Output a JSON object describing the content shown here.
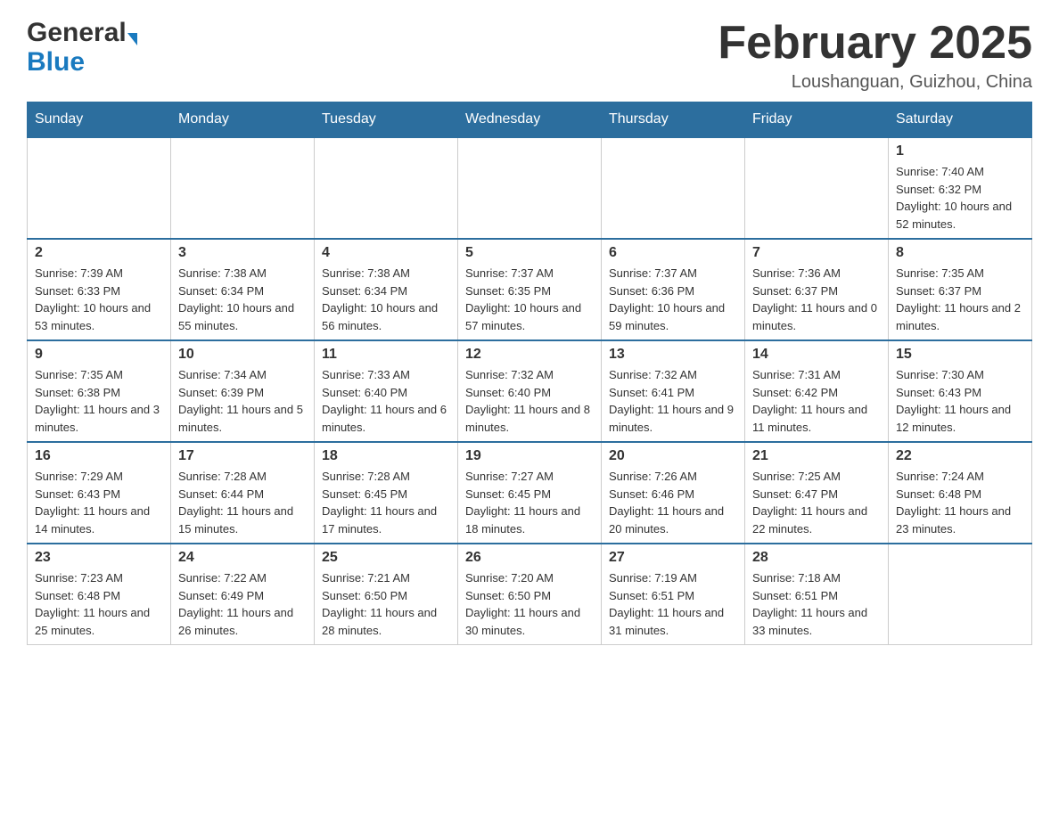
{
  "logo": {
    "general": "General",
    "blue": "Blue"
  },
  "title": "February 2025",
  "subtitle": "Loushanguan, Guizhou, China",
  "days_of_week": [
    "Sunday",
    "Monday",
    "Tuesday",
    "Wednesday",
    "Thursday",
    "Friday",
    "Saturday"
  ],
  "weeks": [
    [
      {
        "day": "",
        "info": ""
      },
      {
        "day": "",
        "info": ""
      },
      {
        "day": "",
        "info": ""
      },
      {
        "day": "",
        "info": ""
      },
      {
        "day": "",
        "info": ""
      },
      {
        "day": "",
        "info": ""
      },
      {
        "day": "1",
        "info": "Sunrise: 7:40 AM\nSunset: 6:32 PM\nDaylight: 10 hours and 52 minutes."
      }
    ],
    [
      {
        "day": "2",
        "info": "Sunrise: 7:39 AM\nSunset: 6:33 PM\nDaylight: 10 hours and 53 minutes."
      },
      {
        "day": "3",
        "info": "Sunrise: 7:38 AM\nSunset: 6:34 PM\nDaylight: 10 hours and 55 minutes."
      },
      {
        "day": "4",
        "info": "Sunrise: 7:38 AM\nSunset: 6:34 PM\nDaylight: 10 hours and 56 minutes."
      },
      {
        "day": "5",
        "info": "Sunrise: 7:37 AM\nSunset: 6:35 PM\nDaylight: 10 hours and 57 minutes."
      },
      {
        "day": "6",
        "info": "Sunrise: 7:37 AM\nSunset: 6:36 PM\nDaylight: 10 hours and 59 minutes."
      },
      {
        "day": "7",
        "info": "Sunrise: 7:36 AM\nSunset: 6:37 PM\nDaylight: 11 hours and 0 minutes."
      },
      {
        "day": "8",
        "info": "Sunrise: 7:35 AM\nSunset: 6:37 PM\nDaylight: 11 hours and 2 minutes."
      }
    ],
    [
      {
        "day": "9",
        "info": "Sunrise: 7:35 AM\nSunset: 6:38 PM\nDaylight: 11 hours and 3 minutes."
      },
      {
        "day": "10",
        "info": "Sunrise: 7:34 AM\nSunset: 6:39 PM\nDaylight: 11 hours and 5 minutes."
      },
      {
        "day": "11",
        "info": "Sunrise: 7:33 AM\nSunset: 6:40 PM\nDaylight: 11 hours and 6 minutes."
      },
      {
        "day": "12",
        "info": "Sunrise: 7:32 AM\nSunset: 6:40 PM\nDaylight: 11 hours and 8 minutes."
      },
      {
        "day": "13",
        "info": "Sunrise: 7:32 AM\nSunset: 6:41 PM\nDaylight: 11 hours and 9 minutes."
      },
      {
        "day": "14",
        "info": "Sunrise: 7:31 AM\nSunset: 6:42 PM\nDaylight: 11 hours and 11 minutes."
      },
      {
        "day": "15",
        "info": "Sunrise: 7:30 AM\nSunset: 6:43 PM\nDaylight: 11 hours and 12 minutes."
      }
    ],
    [
      {
        "day": "16",
        "info": "Sunrise: 7:29 AM\nSunset: 6:43 PM\nDaylight: 11 hours and 14 minutes."
      },
      {
        "day": "17",
        "info": "Sunrise: 7:28 AM\nSunset: 6:44 PM\nDaylight: 11 hours and 15 minutes."
      },
      {
        "day": "18",
        "info": "Sunrise: 7:28 AM\nSunset: 6:45 PM\nDaylight: 11 hours and 17 minutes."
      },
      {
        "day": "19",
        "info": "Sunrise: 7:27 AM\nSunset: 6:45 PM\nDaylight: 11 hours and 18 minutes."
      },
      {
        "day": "20",
        "info": "Sunrise: 7:26 AM\nSunset: 6:46 PM\nDaylight: 11 hours and 20 minutes."
      },
      {
        "day": "21",
        "info": "Sunrise: 7:25 AM\nSunset: 6:47 PM\nDaylight: 11 hours and 22 minutes."
      },
      {
        "day": "22",
        "info": "Sunrise: 7:24 AM\nSunset: 6:48 PM\nDaylight: 11 hours and 23 minutes."
      }
    ],
    [
      {
        "day": "23",
        "info": "Sunrise: 7:23 AM\nSunset: 6:48 PM\nDaylight: 11 hours and 25 minutes."
      },
      {
        "day": "24",
        "info": "Sunrise: 7:22 AM\nSunset: 6:49 PM\nDaylight: 11 hours and 26 minutes."
      },
      {
        "day": "25",
        "info": "Sunrise: 7:21 AM\nSunset: 6:50 PM\nDaylight: 11 hours and 28 minutes."
      },
      {
        "day": "26",
        "info": "Sunrise: 7:20 AM\nSunset: 6:50 PM\nDaylight: 11 hours and 30 minutes."
      },
      {
        "day": "27",
        "info": "Sunrise: 7:19 AM\nSunset: 6:51 PM\nDaylight: 11 hours and 31 minutes."
      },
      {
        "day": "28",
        "info": "Sunrise: 7:18 AM\nSunset: 6:51 PM\nDaylight: 11 hours and 33 minutes."
      },
      {
        "day": "",
        "info": ""
      }
    ]
  ]
}
